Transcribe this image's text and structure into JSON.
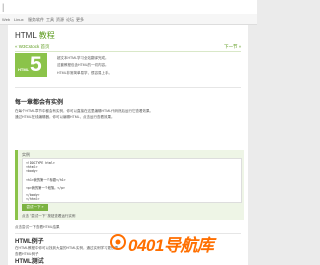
{
  "topbar": {
    "mark": "|"
  },
  "nav": {
    "items": [
      "Web",
      "Linux",
      "服务软件",
      "工具",
      "资源",
      "论坛",
      "更多"
    ]
  },
  "page": {
    "title_prefix": "HTML ",
    "title_accent": "教程",
    "prev_link": "« W3Cstock 首页",
    "next_link": "下一节 »"
  },
  "logo": {
    "number": "5",
    "label": "HTML"
  },
  "intro": {
    "lines": [
      "超文本HTML学习全站翻译完成。",
      "这套教程包含HTML的一切内容。",
      "HTML非常简单易学，很容易上手。"
    ]
  },
  "section1": {
    "heading": "每一章都会有实例",
    "lines": [
      "在每个HTML章节中都会有实例，你可以直接在这里编辑HTML代码然后运行它查看效果。",
      "通过HTML在线编辑器，你可以编辑HTML，点击运行查看效果。"
    ]
  },
  "example": {
    "label": "实例",
    "code": [
      "<!DOCTYPE html>",
      "<html>",
      "<body>",
      "",
      "<h1>我的第一个标题</h1>",
      "",
      "<p>我的第一个段落。</p>",
      "",
      "</body>",
      "</html>"
    ],
    "button": "尝试一下 »",
    "hint": "点击 \"尝试一下\" 按钮查看运行实例"
  },
  "after_example": "点击尝试一下查看HTML结果",
  "section2": {
    "heading": "HTML例子",
    "lines": [
      "在HTML教程中你可以找到大量的HTML实例，通过实例学习更快捷。",
      "查看HTML例子"
    ]
  },
  "section3": {
    "heading": "HTML测试"
  },
  "watermark": {
    "text": "0401导航库"
  },
  "colors": {
    "accent": "#5b9a1b",
    "logo_bg": "#8bc34a",
    "watermark": "#ff6f00"
  }
}
